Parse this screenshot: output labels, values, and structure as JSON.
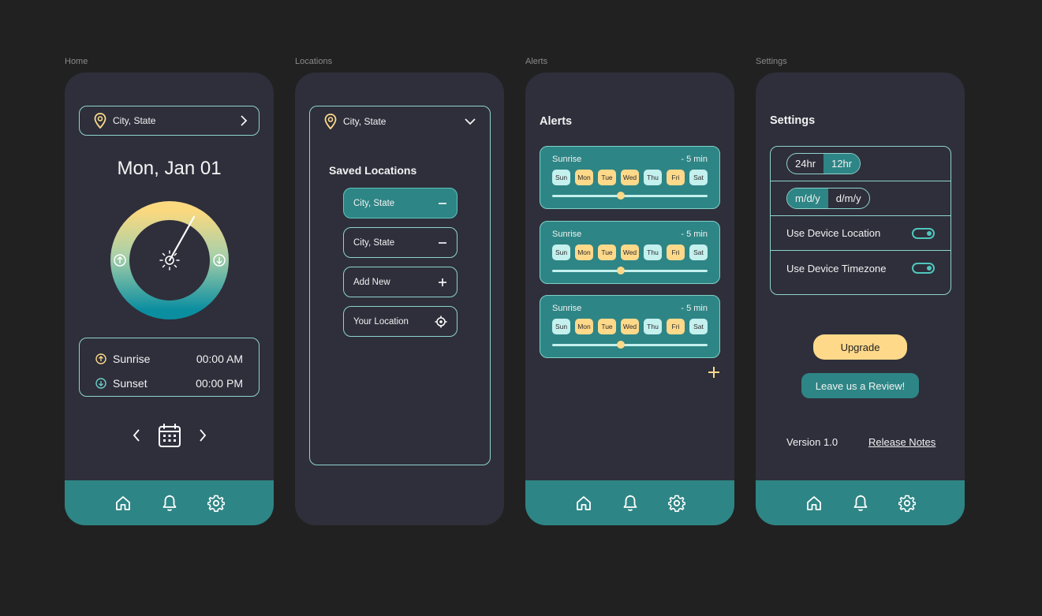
{
  "frames": {
    "home_label": "Home",
    "locations_label": "Locations",
    "alerts_label": "Alerts",
    "settings_label": "Settings"
  },
  "colors": {
    "background": "#212121",
    "phone": "#2e2f3b",
    "teal": "#2e8585",
    "outline": "#8fd3cf",
    "yellow": "#ffd98a",
    "light_teal": "#c4f0ee"
  },
  "home": {
    "location": "City, State",
    "date": "Mon, Jan 01",
    "sunrise_label": "Sunrise",
    "sunrise_time": "00:00 AM",
    "sunset_label": "Sunset",
    "sunset_time": "00:00 PM"
  },
  "locations": {
    "current": "City, State",
    "saved_title": "Saved Locations",
    "items": [
      {
        "label": "City, State",
        "action": "minus-icon",
        "active": true
      },
      {
        "label": "City, State",
        "action": "minus-icon",
        "active": false
      },
      {
        "label": "Add New",
        "action": "plus-icon",
        "active": false
      },
      {
        "label": "Your Location",
        "action": "target-icon",
        "active": false
      }
    ]
  },
  "alerts": {
    "title": "Alerts",
    "cards": [
      {
        "event": "Sunrise",
        "offset": "- 5 min",
        "position": 0.44
      },
      {
        "event": "Sunrise",
        "offset": "- 5 min",
        "position": 0.44
      },
      {
        "event": "Sunrise",
        "offset": "- 5 min",
        "position": 0.44
      }
    ],
    "days": [
      {
        "label": "Sun",
        "on": false
      },
      {
        "label": "Mon",
        "on": true
      },
      {
        "label": "Tue",
        "on": true
      },
      {
        "label": "Wed",
        "on": true
      },
      {
        "label": "Thu",
        "on": false
      },
      {
        "label": "Fri",
        "on": true
      },
      {
        "label": "Sat",
        "on": false
      }
    ]
  },
  "settings": {
    "title": "Settings",
    "time_24": "24hr",
    "time_12": "12hr",
    "time_selected": "12hr",
    "date_mdy": "m/d/y",
    "date_dmy": "d/m/y",
    "date_selected": "m/d/y",
    "use_location": "Use Device Location",
    "use_timezone": "Use Device Timezone",
    "upgrade": "Upgrade",
    "review": "Leave us a Review!",
    "version": "Version 1.0",
    "release_notes": "Release Notes"
  },
  "tabbar": {
    "icons": [
      "home-icon",
      "bell-icon",
      "gear-icon"
    ]
  }
}
